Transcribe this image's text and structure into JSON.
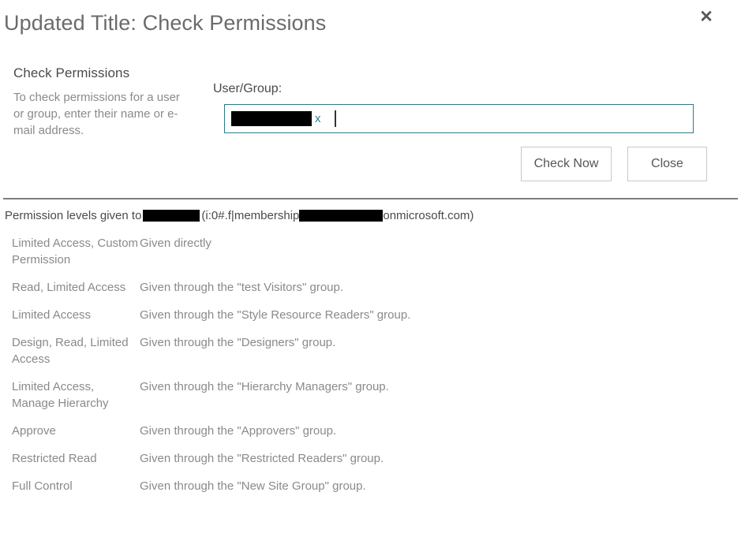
{
  "dialog": {
    "title": "Updated Title: Check Permissions",
    "close_icon": "close-x-icon",
    "close_glyph": "✕"
  },
  "description": {
    "heading": "Check Permissions",
    "body": "To check permissions for a user or group, enter their name or e-mail address."
  },
  "form": {
    "field_label": "User/Group:",
    "token_remove_label": "x",
    "token_value": "",
    "input_placeholder": ""
  },
  "buttons": {
    "check_now": "Check Now",
    "close": "Close"
  },
  "results": {
    "header_prefix": "Permission levels given to",
    "header_middle": "(i:0#.f|membership",
    "header_suffix": "onmicrosoft.com)",
    "rows": [
      {
        "level": "Limited Access, Custom Permission",
        "source": "Given directly"
      },
      {
        "level": "Read, Limited Access",
        "source": "Given through the \"test Visitors\" group."
      },
      {
        "level": "Limited Access",
        "source": "Given through the \"Style Resource Readers\" group."
      },
      {
        "level": "Design, Read, Limited Access",
        "source": "Given through the \"Designers\" group."
      },
      {
        "level": "Limited Access, Manage Hierarchy",
        "source": "Given through the \"Hierarchy Managers\" group."
      },
      {
        "level": "Approve",
        "source": "Given through the \"Approvers\" group."
      },
      {
        "level": "Restricted Read",
        "source": "Given through the \"Restricted Readers\" group."
      },
      {
        "level": "Full Control",
        "source": "Given through the \"New Site Group\" group."
      }
    ]
  },
  "colors": {
    "focus_border": "#2d7c89",
    "token_remove": "#2d7c89",
    "title_text": "#6b6b6b",
    "body_text": "#8a8a8a",
    "divider": "#7f7f7f",
    "button_border": "#c9c9c9",
    "redaction": "#000000"
  }
}
